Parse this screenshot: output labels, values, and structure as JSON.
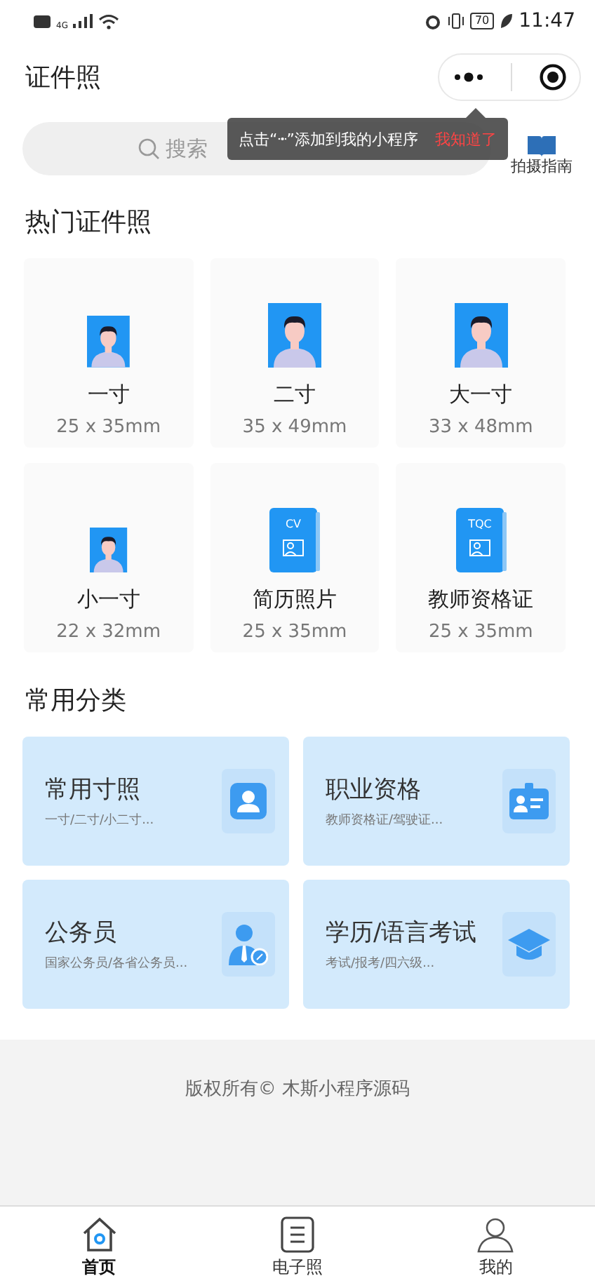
{
  "status_bar": {
    "network": "4G",
    "battery": "70",
    "time": "11:47"
  },
  "header": {
    "title": "证件照"
  },
  "search": {
    "placeholder": "搜索"
  },
  "guide": {
    "label": "拍摄指南"
  },
  "tooltip": {
    "before": "点击“",
    "after": "”添加到我的小程序",
    "action": "我知道了"
  },
  "hot": {
    "title": "热门证件照",
    "items": [
      {
        "kind": "photo",
        "name": "一寸",
        "size": "25 x 35mm"
      },
      {
        "kind": "photo",
        "name": "二寸",
        "size": "35 x 49mm"
      },
      {
        "kind": "photo",
        "name": "大一寸",
        "size": "33 x 48mm"
      },
      {
        "kind": "photo",
        "name": "小一寸",
        "size": "22 x 32mm"
      },
      {
        "kind": "doc",
        "name": "简历照片",
        "size": "25 x 35mm",
        "badge": "CV"
      },
      {
        "kind": "doc",
        "name": "教师资格证",
        "size": "25 x 35mm",
        "badge": "TQC"
      }
    ]
  },
  "categories": {
    "title": "常用分类",
    "items": [
      {
        "kind": "person",
        "name": "常用寸照",
        "desc": "一寸/二寸/小二寸..."
      },
      {
        "kind": "card",
        "name": "职业资格",
        "desc": "教师资格证/驾驶证..."
      },
      {
        "kind": "officer",
        "name": "公务员",
        "desc": "国家公务员/各省公务员..."
      },
      {
        "kind": "cap",
        "name": "学历/语言考试",
        "desc": "考试/报考/四六级..."
      }
    ]
  },
  "footer": {
    "copyright": "版权所有© 木斯小程序源码"
  },
  "tabs": [
    {
      "label": "首页",
      "kind": "home",
      "selected": true
    },
    {
      "label": "电子照",
      "kind": "doc",
      "selected": false
    },
    {
      "label": "我的",
      "kind": "user",
      "selected": false
    }
  ]
}
